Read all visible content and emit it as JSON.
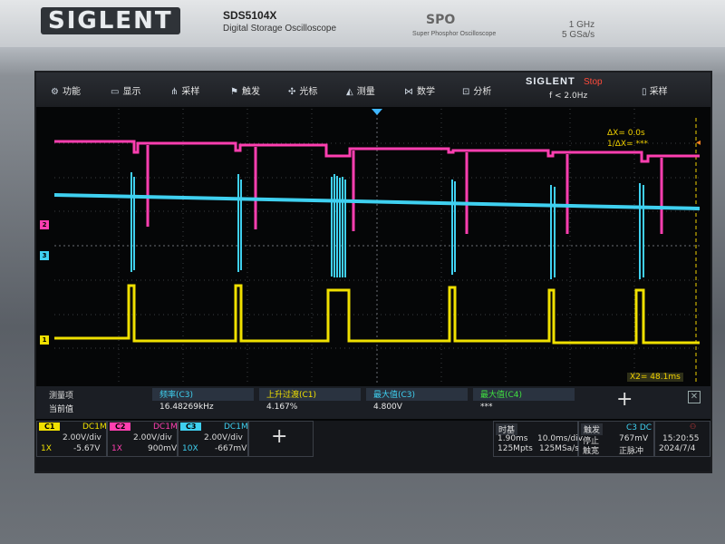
{
  "device": {
    "brand": "SIGLENT",
    "model": "SDS5104X",
    "description": "Digital Storage Oscilloscope",
    "spo_logo": "SPO",
    "spo_description": "Super Phosphor Oscilloscope",
    "bandwidth": "1 GHz",
    "sample_rate": "5 GSa/s"
  },
  "menubar": {
    "items": [
      {
        "icon": "gear-icon",
        "label": "功能"
      },
      {
        "icon": "display-icon",
        "label": "显示"
      },
      {
        "icon": "acquire-icon",
        "label": "采样"
      },
      {
        "icon": "trigger-icon",
        "label": "触发"
      },
      {
        "icon": "cursor-icon",
        "label": "光标"
      },
      {
        "icon": "measure-icon",
        "label": "测量"
      },
      {
        "icon": "math-icon",
        "label": "数学"
      },
      {
        "icon": "analysis-icon",
        "label": "分析"
      }
    ],
    "logo": "SIGLENT",
    "status": "Stop",
    "frequency": "f < 2.0Hz",
    "acquire_label": "采样"
  },
  "cursor_readout": {
    "dx": "ΔX= 0.0s",
    "inv_dx": "1/ΔX= ***",
    "x2": "X2= 48.1ms"
  },
  "colors": {
    "ch1": "#f0e000",
    "ch2": "#ff3fb0",
    "ch3": "#3fd0f0",
    "ch4": "#40e040"
  },
  "measure": {
    "header_label": "测量项",
    "value_label": "当前值",
    "items": [
      {
        "name": "频率(C3)",
        "value": "16.48269kHz",
        "color": "#3fd0f0"
      },
      {
        "name": "上升过渡(C1)",
        "value": "4.167%",
        "color": "#f0e000"
      },
      {
        "name": "最大值(C3)",
        "value": "4.800V",
        "color": "#3fd0f0"
      },
      {
        "name": "最大值(C4)",
        "value": "***",
        "color": "#40e040"
      }
    ]
  },
  "channels": [
    {
      "label": "C1",
      "coupling": "DC1M",
      "scale": "2.00V/div",
      "probe": "1X",
      "offset": "-5.67V"
    },
    {
      "label": "C2",
      "coupling": "DC1M",
      "scale": "2.00V/div",
      "probe": "1X",
      "offset": "900mV"
    },
    {
      "label": "C3",
      "coupling": "DC1M",
      "scale": "2.00V/div",
      "probe": "10X",
      "offset": "-667mV"
    }
  ],
  "timebase": {
    "title": "时基",
    "delay": "1.90ms",
    "scale": "10.0ms/div",
    "memory": "125Mpts",
    "rate": "125MSa/s"
  },
  "trigger": {
    "title": "触发",
    "source": "C3 DC",
    "mode": "停止",
    "level": "767mV",
    "type": "触宽",
    "edge": "正脉冲"
  },
  "clock": {
    "time": "15:20:55",
    "date": "2024/7/4"
  }
}
